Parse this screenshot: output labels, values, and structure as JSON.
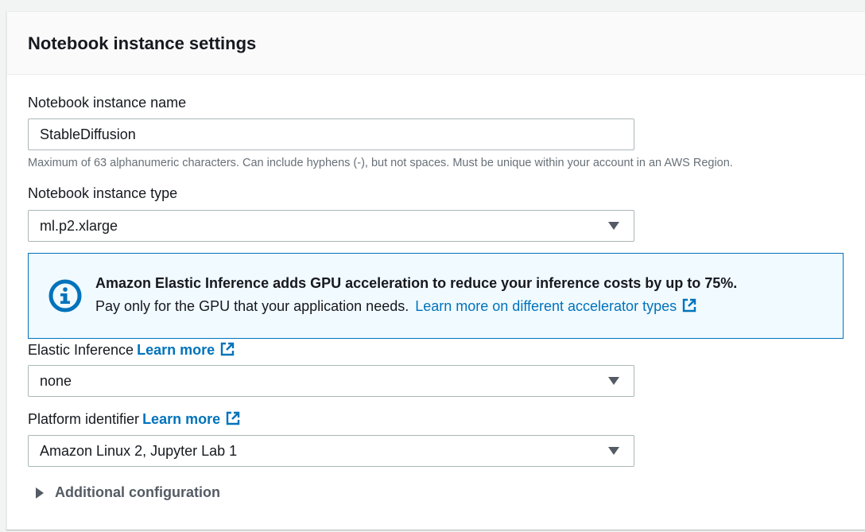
{
  "panel": {
    "title": "Notebook instance settings"
  },
  "name_field": {
    "label": "Notebook instance name",
    "value": "StableDiffusion",
    "hint": "Maximum of 63 alphanumeric characters. Can include hyphens (-), but not spaces. Must be unique within your account in an AWS Region."
  },
  "type_field": {
    "label": "Notebook instance type",
    "value": "ml.p2.xlarge"
  },
  "info_alert": {
    "icon": "info-icon",
    "headline": "Amazon Elastic Inference adds GPU acceleration to reduce your inference costs by up to 75%.",
    "body": "Pay only for the GPU that your application needs.",
    "link": "Learn more on different accelerator types"
  },
  "elastic_inference": {
    "label": "Elastic Inference",
    "link": "Learn more",
    "value": "none"
  },
  "platform_identifier": {
    "label": "Platform identifier",
    "link": "Learn more",
    "value": "Amazon Linux 2, Jupyter Lab 1"
  },
  "additional_config": {
    "label": "Additional configuration"
  },
  "colors": {
    "link": "#0073bb",
    "info_bg": "#f1faff",
    "info_border": "#0073bb",
    "text": "#16191f",
    "muted": "#687078"
  }
}
